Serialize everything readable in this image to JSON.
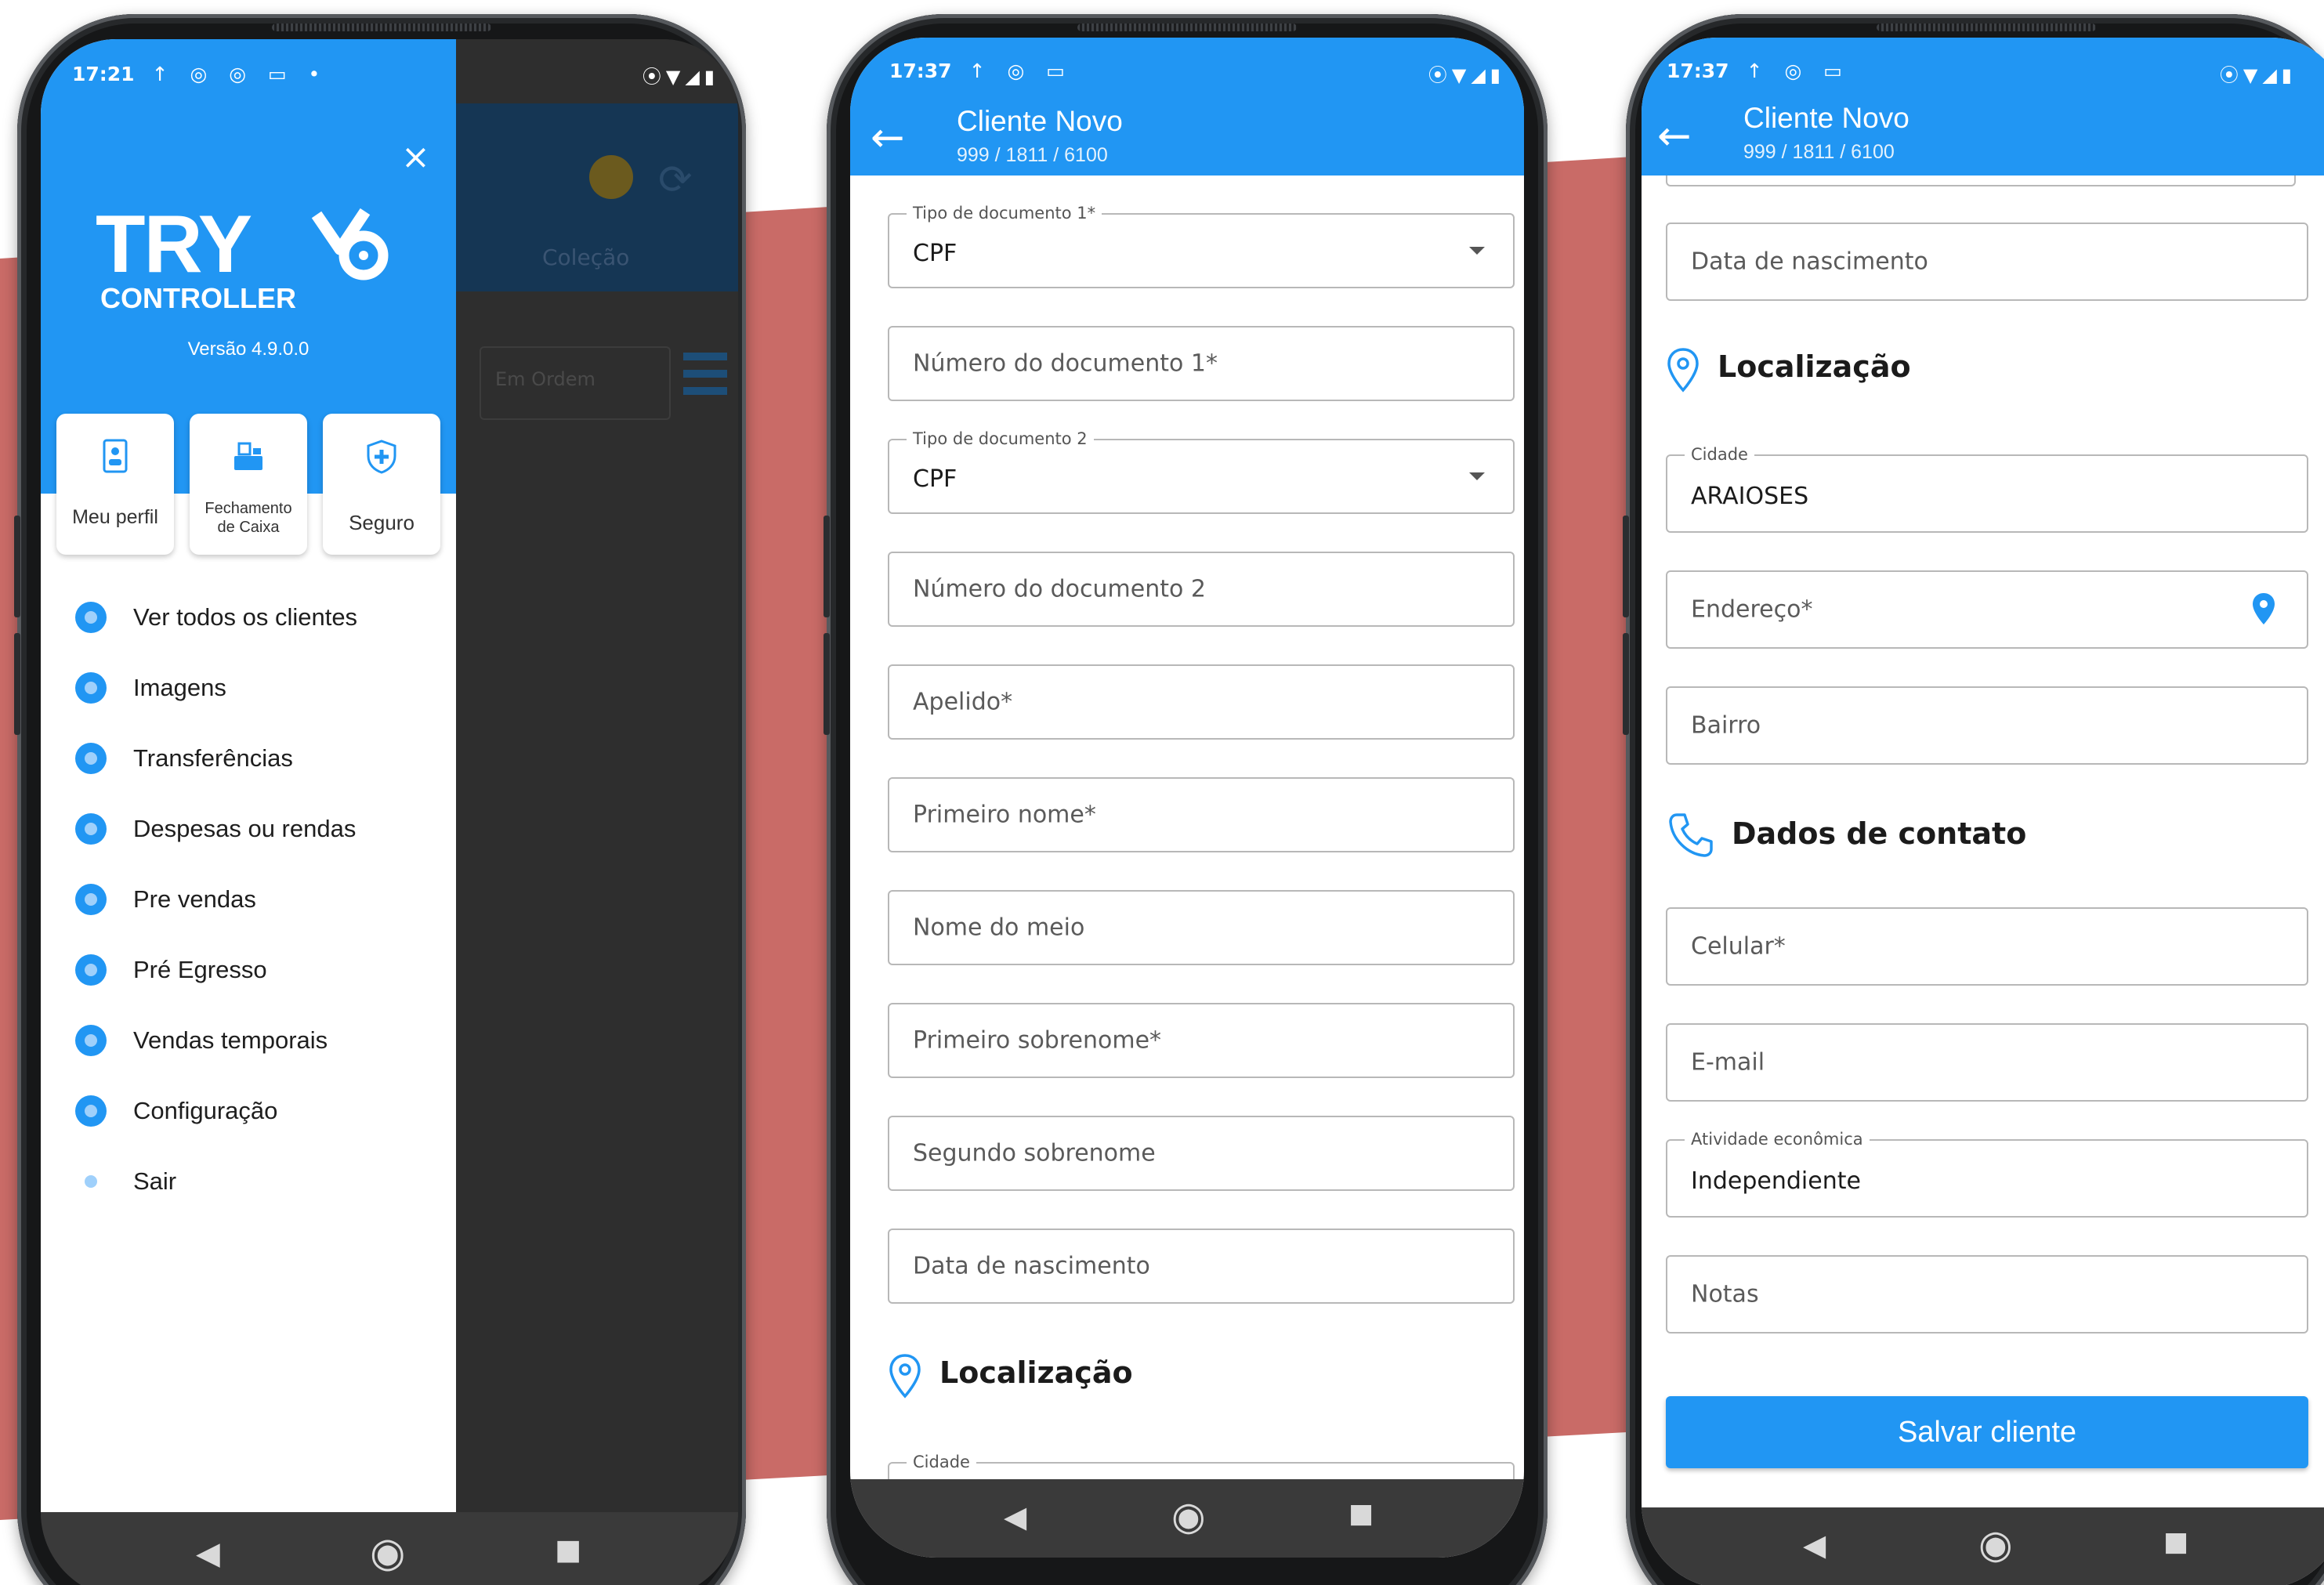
{
  "colors": {
    "primary": "#2196f3",
    "accent_band": "#c96b67",
    "nav_bar": "#3a3a3a",
    "overlay": "#2e2e2e"
  },
  "phone1": {
    "status": {
      "time": "17:21",
      "icons": "↑ ◎ ◎ ▭ •"
    },
    "logo": {
      "brand": "TRY",
      "sub": "CONTROLLER",
      "version": "Versão 4.9.0.0"
    },
    "close_icon": "×",
    "quick_actions": [
      {
        "label": "Meu perfil",
        "icon": "profile-icon"
      },
      {
        "label": "Fechamento",
        "label2": "de Caixa",
        "icon": "cash-register-icon"
      },
      {
        "label": "Seguro",
        "icon": "shield-icon"
      }
    ],
    "menu": [
      {
        "label": "Ver todos os clientes"
      },
      {
        "label": "Imagens"
      },
      {
        "label": "Transferências"
      },
      {
        "label": "Despesas ou rendas"
      },
      {
        "label": "Pre vendas"
      },
      {
        "label": "Pré Egresso"
      },
      {
        "label": "Vendas temporais"
      },
      {
        "label": "Configuração"
      },
      {
        "label": "Sair"
      }
    ],
    "background": {
      "tab_label": "Coleção",
      "filter_label": "Em Ordem"
    }
  },
  "phone2": {
    "status": {
      "time": "17:37",
      "icons": "↑ ◎ ▭"
    },
    "title": "Cliente Novo",
    "subtitle": "999 / 1811 / 6100",
    "fields": [
      {
        "label": "Tipo de documento 1*",
        "value": "CPF"
      },
      {
        "placeholder": "Número do documento 1*"
      },
      {
        "label": "Tipo de documento 2",
        "value": "CPF"
      },
      {
        "placeholder": "Número do documento 2"
      },
      {
        "placeholder": "Apelido*"
      },
      {
        "placeholder": "Primeiro nome*"
      },
      {
        "placeholder": "Nome do meio"
      },
      {
        "placeholder": "Primeiro sobrenome*"
      },
      {
        "placeholder": "Segundo sobrenome"
      },
      {
        "placeholder": "Data de nascimento"
      }
    ],
    "section_location": "Localização",
    "city_label": "Cidade"
  },
  "phone3": {
    "status": {
      "time": "17:37",
      "icons": "↑ ◎ ▭"
    },
    "title": "Cliente Novo",
    "subtitle": "999 / 1811 / 6100",
    "birth_placeholder": "Data de nascimento",
    "section_location": "Localização",
    "city": {
      "label": "Cidade",
      "value": "ARAIOSES"
    },
    "address_placeholder": "Endereço*",
    "district_placeholder": "Bairro",
    "section_contact": "Dados de contato",
    "phone_placeholder": "Celular*",
    "email_placeholder": "E-mail",
    "activity": {
      "label": "Atividade econômica",
      "value": "Independiente"
    },
    "notes_placeholder": "Notas",
    "save_label": "Salvar cliente"
  }
}
